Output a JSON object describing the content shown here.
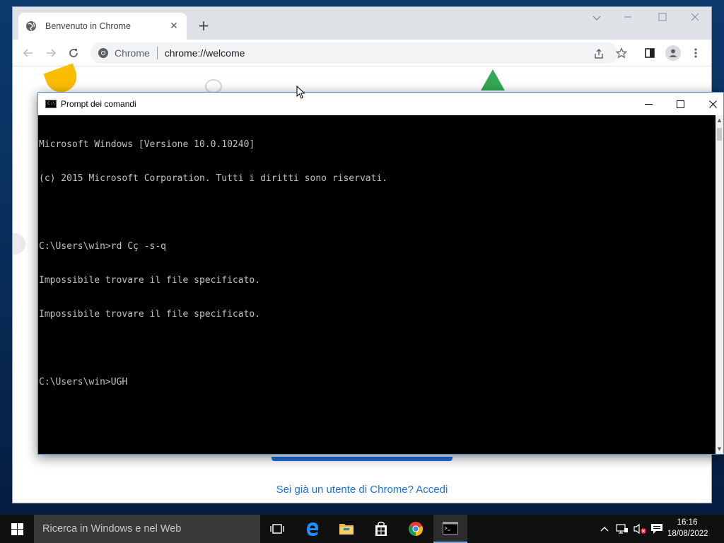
{
  "chrome": {
    "tab_title": "Benvenuto in Chrome",
    "tab_close": "✕",
    "new_tab": "+",
    "omnibox_site": "Chrome",
    "omnibox_url": "chrome://welcome",
    "signin_link": "Sei già un utente di Chrome? Accedi",
    "brand_colors": {
      "yellow": "#fbbc04",
      "green": "#34a853",
      "blue": "#1a73e8"
    }
  },
  "cmd": {
    "title": "Prompt dei comandi",
    "icon_text": "C:\\",
    "lines": [
      "Microsoft Windows [Versione 10.0.10240]",
      "(c) 2015 Microsoft Corporation. Tutti i diritti sono riservati.",
      "",
      "C:\\Users\\win>rd Cç -s-q",
      "Impossibile trovare il file specificato.",
      "Impossibile trovare il file specificato.",
      "",
      "C:\\Users\\win>UGH"
    ],
    "minimize": "—",
    "close": "✕"
  },
  "taskbar": {
    "search_placeholder": "Ricerca in Windows e nel Web",
    "time": "16:16",
    "date": "18/08/2022",
    "tray_chevron": "^"
  }
}
